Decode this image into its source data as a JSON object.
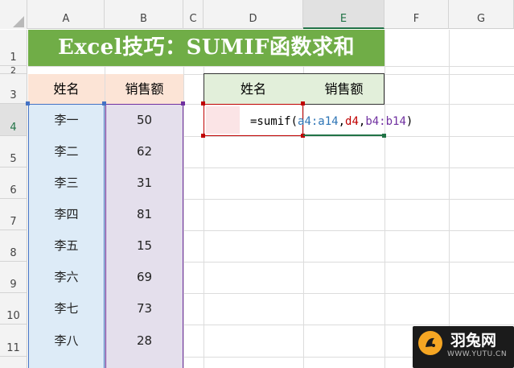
{
  "columns": [
    "A",
    "B",
    "C",
    "D",
    "E",
    "F",
    "G"
  ],
  "rows": [
    "1",
    "2",
    "3",
    "4",
    "5",
    "6",
    "7",
    "8",
    "9",
    "10",
    "11"
  ],
  "title": "Excel技巧：SUMIF函数求和",
  "left_table": {
    "headers": [
      "姓名",
      "销售额"
    ],
    "rows": [
      [
        "李一",
        "50"
      ],
      [
        "李二",
        "62"
      ],
      [
        "李三",
        "31"
      ],
      [
        "李四",
        "81"
      ],
      [
        "李五",
        "15"
      ],
      [
        "李六",
        "69"
      ],
      [
        "李七",
        "73"
      ],
      [
        "李八",
        "28"
      ]
    ]
  },
  "right_table": {
    "headers": [
      "姓名",
      "销售额"
    ]
  },
  "formula": {
    "prefix": "=sumif(",
    "arg1": "a4:a14",
    "sep1": ",",
    "arg2": "d4",
    "sep2": ",",
    "arg3": "b4:b14",
    "suffix": ")"
  },
  "colors": {
    "title_bg": "#70ad47",
    "left_header_bg": "#fce4d6",
    "name_col_bg": "#ddebf7",
    "sales_col_bg": "#e4dfec",
    "right_header_bg": "#e2efda",
    "arg1": "#2e75b6",
    "arg2": "#c00000",
    "arg3": "#7030a0"
  },
  "watermark": {
    "brand": "羽兔网",
    "url": "WWW.YUTU.CN"
  }
}
